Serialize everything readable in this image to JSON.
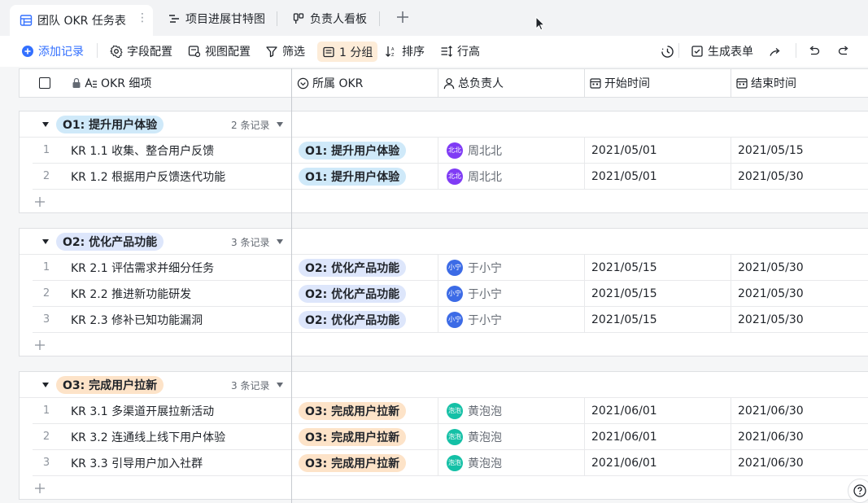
{
  "tabs": [
    {
      "label": "团队 OKR 任务表",
      "active": true
    },
    {
      "label": "项目进展甘特图",
      "active": false
    },
    {
      "label": "负责人看板",
      "active": false
    }
  ],
  "toolbar": {
    "add_record": "添加记录",
    "field_config": "字段配置",
    "view_config": "视图配置",
    "filter": "筛选",
    "group": "1 分组",
    "sort": "排序",
    "row_height": "行高",
    "generate_form": "生成表单"
  },
  "columns": [
    {
      "label": "OKR 细项",
      "icon": "text-lock-icon"
    },
    {
      "label": "所属 OKR",
      "icon": "select-icon"
    },
    {
      "label": "总负责人",
      "icon": "person-icon"
    },
    {
      "label": "开始时间",
      "icon": "calendar-icon"
    },
    {
      "label": "结束时间",
      "icon": "calendar-icon"
    }
  ],
  "groups": [
    {
      "label": "O1: 提升用户体验",
      "color": "#cfe9f9",
      "count": "2 条记录",
      "rows": [
        {
          "num": "1",
          "item": "KR 1.1 收集、整合用户反馈",
          "okr": "O1: 提升用户体验",
          "owner": "周北北",
          "avatar": "北北",
          "avatar_color": "#7f3bf5",
          "start": "2021/05/01",
          "end": "2021/05/15"
        },
        {
          "num": "2",
          "item": "KR 1.2 根据用户反馈迭代功能",
          "okr": "O1: 提升用户体验",
          "owner": "周北北",
          "avatar": "北北",
          "avatar_color": "#7f3bf5",
          "start": "2021/05/01",
          "end": "2021/05/30"
        }
      ]
    },
    {
      "label": "O2: 优化产品功能",
      "color": "#dde6fb",
      "count": "3 条记录",
      "rows": [
        {
          "num": "1",
          "item": "KR 2.1 评估需求并细分任务",
          "okr": "O2: 优化产品功能",
          "owner": "于小宁",
          "avatar": "小宁",
          "avatar_color": "#3c6be6",
          "start": "2021/05/15",
          "end": "2021/05/30"
        },
        {
          "num": "2",
          "item": "KR 2.2 推进新功能研发",
          "okr": "O2: 优化产品功能",
          "owner": "于小宁",
          "avatar": "小宁",
          "avatar_color": "#3c6be6",
          "start": "2021/05/15",
          "end": "2021/05/30"
        },
        {
          "num": "3",
          "item": "KR 2.3 修补已知功能漏洞",
          "okr": "O2: 优化产品功能",
          "owner": "于小宁",
          "avatar": "小宁",
          "avatar_color": "#3c6be6",
          "start": "2021/05/15",
          "end": "2021/05/30"
        }
      ]
    },
    {
      "label": "O3: 完成用户拉新",
      "color": "#fde3c8",
      "count": "3 条记录",
      "rows": [
        {
          "num": "1",
          "item": "KR 3.1 多渠道开展拉新活动",
          "okr": "O3: 完成用户拉新",
          "owner": "黄泡泡",
          "avatar": "泡泡",
          "avatar_color": "#14c0a6",
          "start": "2021/06/01",
          "end": "2021/06/30"
        },
        {
          "num": "2",
          "item": "KR 3.2 连通线上线下用户体验",
          "okr": "O3: 完成用户拉新",
          "owner": "黄泡泡",
          "avatar": "泡泡",
          "avatar_color": "#14c0a6",
          "start": "2021/06/01",
          "end": "2021/06/30"
        },
        {
          "num": "3",
          "item": "KR 3.3 引导用户加入社群",
          "okr": "O3: 完成用户拉新",
          "owner": "黄泡泡",
          "avatar": "泡泡",
          "avatar_color": "#14c0a6",
          "start": "2021/06/01",
          "end": "2021/06/30"
        }
      ]
    }
  ]
}
